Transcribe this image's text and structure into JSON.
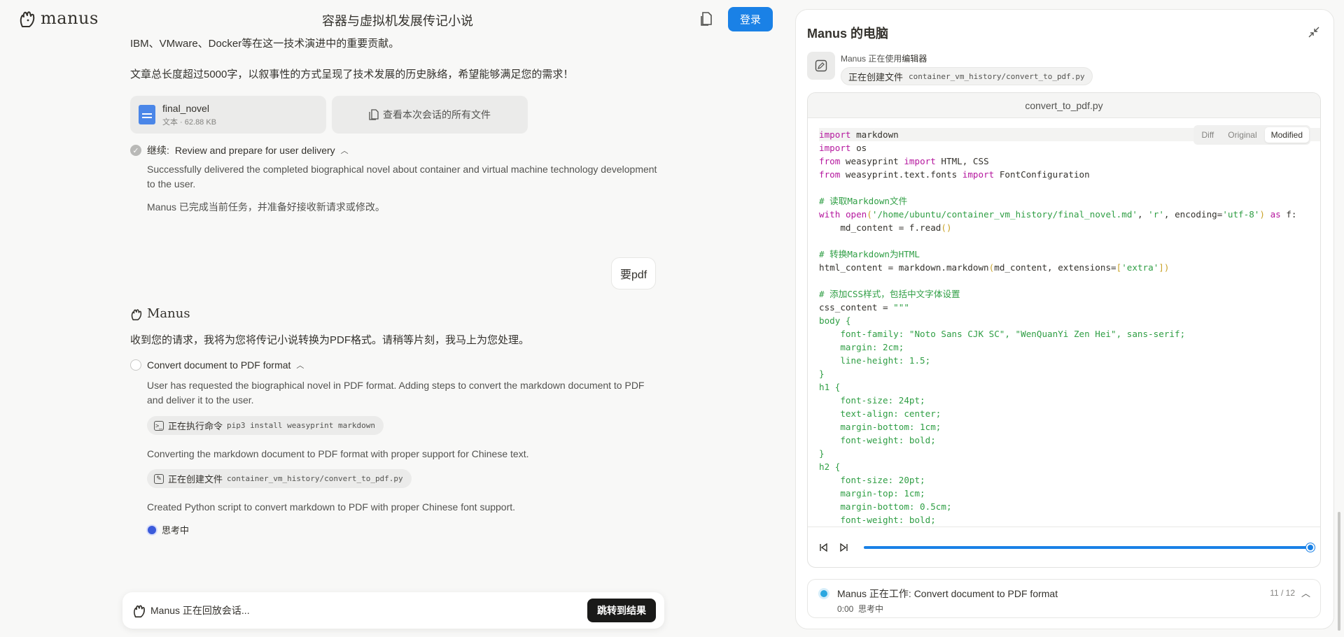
{
  "header": {
    "logo_text": "manus",
    "chat_title": "容器与虚拟机发展传记小说",
    "login_label": "登录"
  },
  "chat": {
    "intro_line": "IBM、VMware、Docker等在这一技术演进中的重要贡献。",
    "summary_line": "文章总长度超过5000字，以叙事性的方式呈现了技术发展的历史脉络，希望能够满足您的需求！",
    "file": {
      "name": "final_novel",
      "meta": "文本 · 62.88 KB"
    },
    "all_files_label": "查看本次会话的所有文件",
    "step1": {
      "prefix": "继续:",
      "title": "Review and prepare for user delivery",
      "desc": "Successfully delivered the completed biographical novel about container and virtual machine technology development to the user.",
      "done_note": "Manus 已完成当前任务，并准备好接收新请求或修改。"
    },
    "user_message": "要pdf",
    "agent_name": "Manus",
    "agent_reply": "收到您的请求，我将为您将传记小说转换为PDF格式。请稍等片刻，我马上为您处理。",
    "step2": {
      "title": "Convert document to PDF format",
      "desc": "User has requested the biographical novel in PDF format. Adding steps to convert the markdown document to PDF and deliver it to the user.",
      "cmd_chip_label": "正在执行命令",
      "cmd_chip_value": "pip3 install weasyprint markdown",
      "note1": "Converting the markdown document to PDF format with proper support for Chinese text.",
      "file_chip_label": "正在创建文件",
      "file_chip_value": "container_vm_history/convert_to_pdf.py",
      "note2": "Created Python script to convert markdown to PDF with proper Chinese font support.",
      "thinking": "思考中"
    }
  },
  "replay_bar": {
    "text": "Manus 正在回放会话...",
    "jump_label": "跳转到结果"
  },
  "panel": {
    "title": "Manus 的电脑",
    "status_prefix": "Manus 正在使用",
    "status_tool": "编辑器",
    "status_action": "正在创建文件",
    "status_path": "container_vm_history/convert_to_pdf.py",
    "code_filename": "convert_to_pdf.py",
    "tabs": [
      "Diff",
      "Original",
      "Modified"
    ],
    "active_tab": "Modified",
    "code_lines": [
      "import markdown",
      "import os",
      "from weasyprint import HTML, CSS",
      "from weasyprint.text.fonts import FontConfiguration",
      "",
      "# 读取Markdown文件",
      "with open('/home/ubuntu/container_vm_history/final_novel.md', 'r', encoding='utf-8') as f:",
      "    md_content = f.read()",
      "",
      "# 转换Markdown为HTML",
      "html_content = markdown.markdown(md_content, extensions=['extra'])",
      "",
      "# 添加CSS样式，包括中文字体设置",
      "css_content = \"\"\"",
      "body {",
      "    font-family: \"Noto Sans CJK SC\", \"WenQuanYi Zen Hei\", sans-serif;",
      "    margin: 2cm;",
      "    line-height: 1.5;",
      "}",
      "h1 {",
      "    font-size: 24pt;",
      "    text-align: center;",
      "    margin-bottom: 1cm;",
      "    font-weight: bold;",
      "}",
      "h2 {",
      "    font-size: 20pt;",
      "    margin-top: 1cm;",
      "    margin-bottom: 0.5cm;",
      "    font-weight: bold;",
      "}"
    ],
    "progress": 1.0,
    "task": {
      "title": "Manus 正在工作: Convert document to PDF format",
      "time": "0:00",
      "sub": "思考中",
      "count": "11 / 12"
    }
  },
  "colors": {
    "accent": "#1a81e6",
    "keyword": "#b5179e",
    "string": "#2f9e44"
  }
}
